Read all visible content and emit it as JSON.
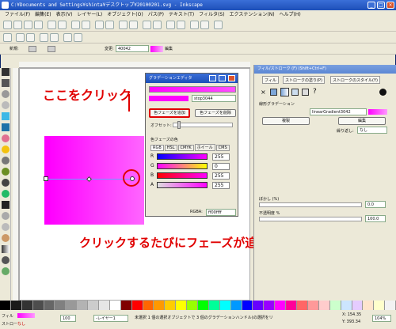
{
  "window": {
    "title": "C:¥Documents and Settings¥shinta¥デスクトップ¥20100201.svg - Inkscape"
  },
  "menubar": {
    "items": [
      "ファイル(F)",
      "編集(E)",
      "表示(V)",
      "レイヤー(L)",
      "オブジェクト(O)",
      "パス(P)",
      "テキスト(T)",
      "フィルタ(S)",
      "エクステンション(N)",
      "ヘルプ(H)"
    ]
  },
  "controlbar": {
    "new_label": "新規:",
    "edit_label": "変更:",
    "gradient_name": "40042",
    "edit_button": "編集"
  },
  "dialog": {
    "title": "グラデーションエディタ",
    "stop_label": "stop3044",
    "add_stop": "色フェーズを追加",
    "delete_stop": "色フェーズを削除",
    "offset_label": "オフセット:",
    "offset_value": "0.00",
    "color_section": "色フェーズの色",
    "tabs": [
      "RGB",
      "HSL",
      "CMYK",
      "ホイール",
      "CMS"
    ],
    "rows": [
      {
        "label": "R",
        "value": "255"
      },
      {
        "label": "G",
        "value": "0"
      },
      {
        "label": "B",
        "value": "255"
      },
      {
        "label": "A",
        "value": "255"
      }
    ],
    "rgba_label": "RGBA:",
    "rgba_value": "ff00ffff"
  },
  "panel": {
    "title": "フィル/ストローク (F) (Shift+Ctrl+F)",
    "tabs": [
      "フィル",
      "ストロークの塗り(P)",
      "ストロークのスタイル(Y)"
    ],
    "section_title": "線形グラデーション",
    "gradient_value": "linearGradient3042",
    "duplicate_button": "複製",
    "edit_button": "編集",
    "repeat_label": "繰り返し:",
    "repeat_value": "なし",
    "blur_label": "ぼかし (%)",
    "blur_value": "0.0",
    "opacity_label": "不透明度 %",
    "opacity_value": "100.0"
  },
  "statusbar": {
    "fill_label": "フィル",
    "stroke_label": "ストロー",
    "stroke_value": "なし",
    "opacity_value": "100",
    "layer": "-レイヤー1",
    "message": "未選択 1 個の選択オブジェクトで 3 個のグラデーションハンドル(の選択をリ",
    "coords_x": "X: 154.35",
    "coords_y": "Y: 393.34",
    "zoom": "104%"
  },
  "callouts": {
    "click_here": "ここをクリック",
    "each_click": "クリックするたびにフェーズが追加できる"
  },
  "palette": {
    "colors": [
      "#000000",
      "#1a1a1a",
      "#333333",
      "#4d4d4d",
      "#666666",
      "#808080",
      "#999999",
      "#b3b3b3",
      "#cccccc",
      "#e6e6e6",
      "#ffffff",
      "#800000",
      "#ff0000",
      "#ff6600",
      "#ff9900",
      "#ffcc00",
      "#ffff00",
      "#99ff00",
      "#00ff00",
      "#00ff99",
      "#00ffff",
      "#0099ff",
      "#0000ff",
      "#6600ff",
      "#9900ff",
      "#ff00ff",
      "#ff0099",
      "#ff6666",
      "#ff9999",
      "#ffcccc",
      "#ccffcc",
      "#cce5ff",
      "#e5ccff",
      "#ffe5cc",
      "#ffffcc",
      "#f2f2f2"
    ]
  }
}
